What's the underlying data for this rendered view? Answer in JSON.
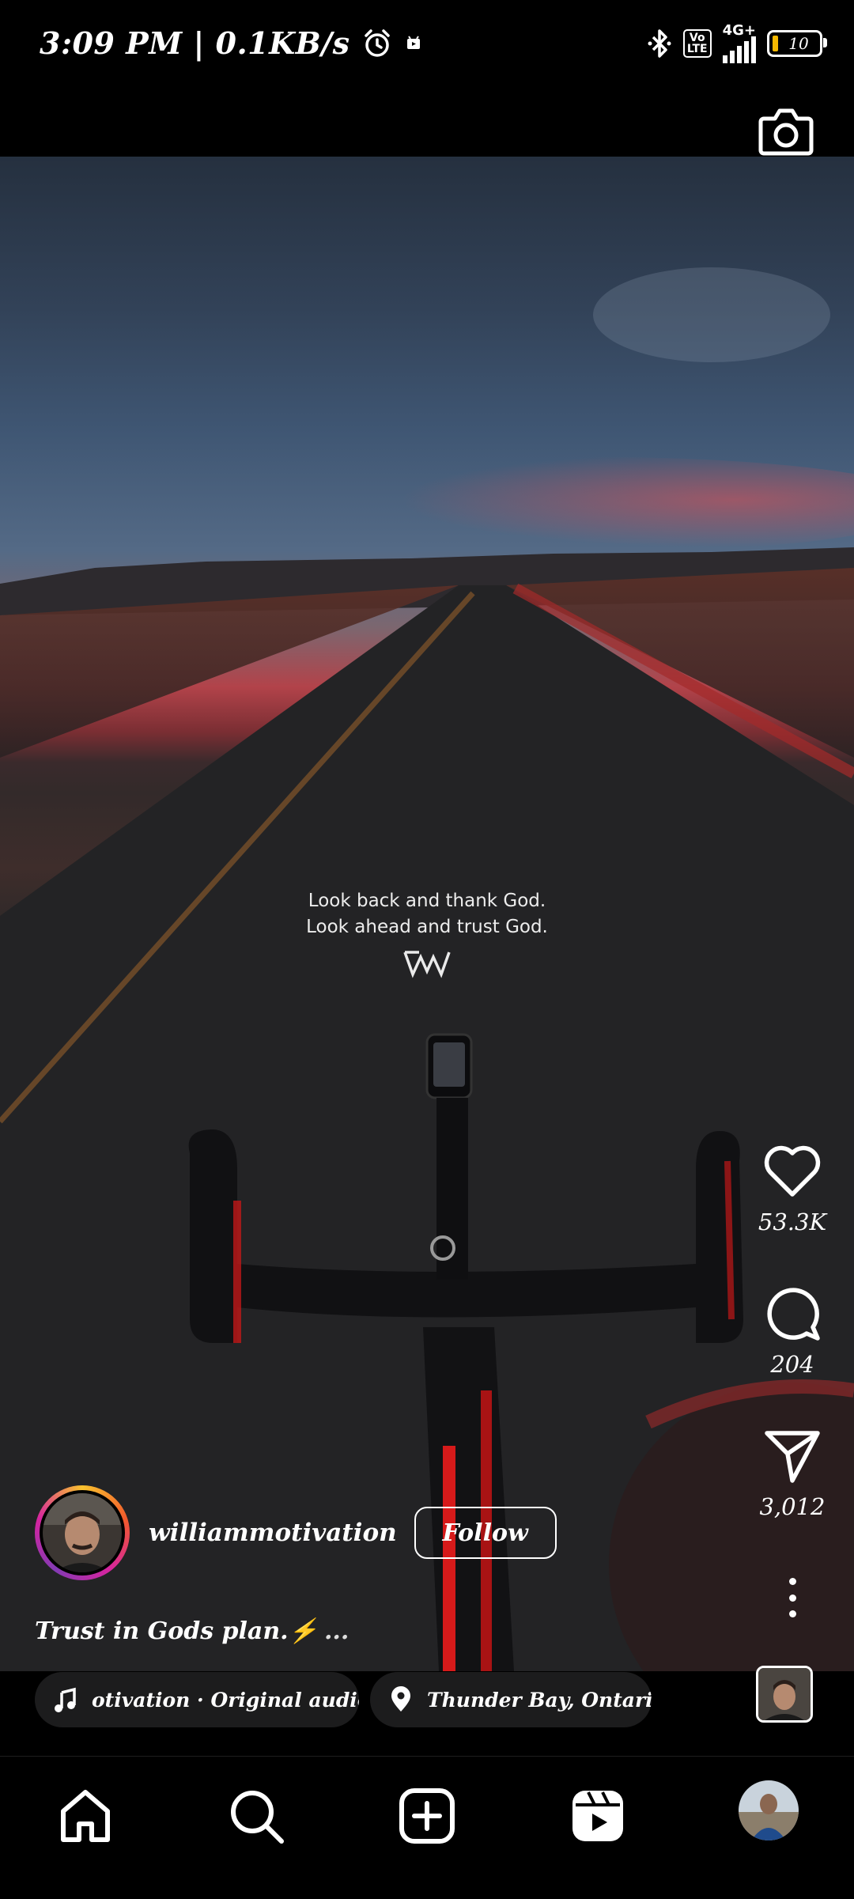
{
  "status_bar": {
    "time_speed": "3:09 PM | 0.1KB/s",
    "network_label": "4G+",
    "volte_label": "Vo\nLTE",
    "battery": "10"
  },
  "video": {
    "overlay_line1": "Look back and thank God.",
    "overlay_line2": "Look ahead and trust God."
  },
  "actions": {
    "likes": "53.3K",
    "comments": "204",
    "shares": "3,012"
  },
  "author": {
    "username": "williammotivation",
    "follow_label": "Follow"
  },
  "caption": {
    "text": "Trust in Gods plan.⚡",
    "more": "..."
  },
  "audio": {
    "label": "otivation · Original audio   u"
  },
  "location": {
    "label": "Thunder Bay, Ontario"
  },
  "icons": {
    "status": [
      "alarm-icon",
      "notification-icon",
      "bluetooth-icon",
      "signal-icon",
      "battery-icon"
    ],
    "rail": [
      "heart-icon",
      "comment-icon",
      "share-icon",
      "more-icon"
    ],
    "nav": [
      "home-icon",
      "search-icon",
      "create-icon",
      "reels-icon",
      "profile-avatar"
    ]
  },
  "colors": {
    "battery_fill": "#f5b800",
    "story_ring": [
      "#f9c22e",
      "#d6249f",
      "#833ab4"
    ]
  }
}
